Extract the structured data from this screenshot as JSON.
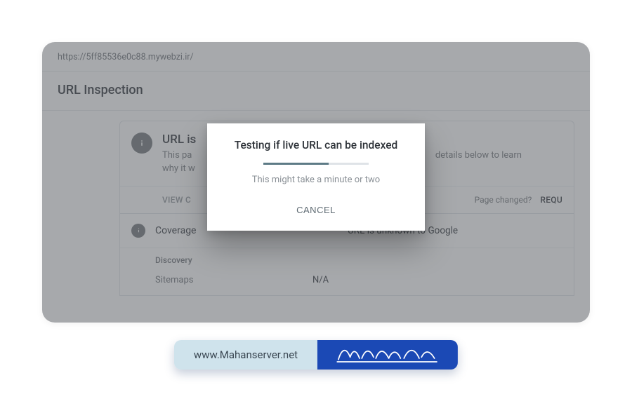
{
  "inspected_url": "https://5ff85536e0c88.mywebzi.ir/",
  "page_title": "URL Inspection",
  "card": {
    "title": "URL is",
    "desc_line1": "This pa",
    "desc_line2": "why it w",
    "desc_tail": "details below to learn",
    "view_label": "VIEW C",
    "page_changed_label": "Page changed?",
    "request_label": "REQU"
  },
  "coverage": {
    "label": "Coverage",
    "value": "URL is unknown to Google",
    "discovery_heading": "Discovery",
    "sitemaps_label": "Sitemaps",
    "sitemaps_value": "N/A"
  },
  "dialog": {
    "title": "Testing if live URL can be indexed",
    "subtitle": "This might take a minute or two",
    "cancel_label": "CANCEL"
  },
  "brand": {
    "url_text": "www.Mahanserver.net"
  }
}
